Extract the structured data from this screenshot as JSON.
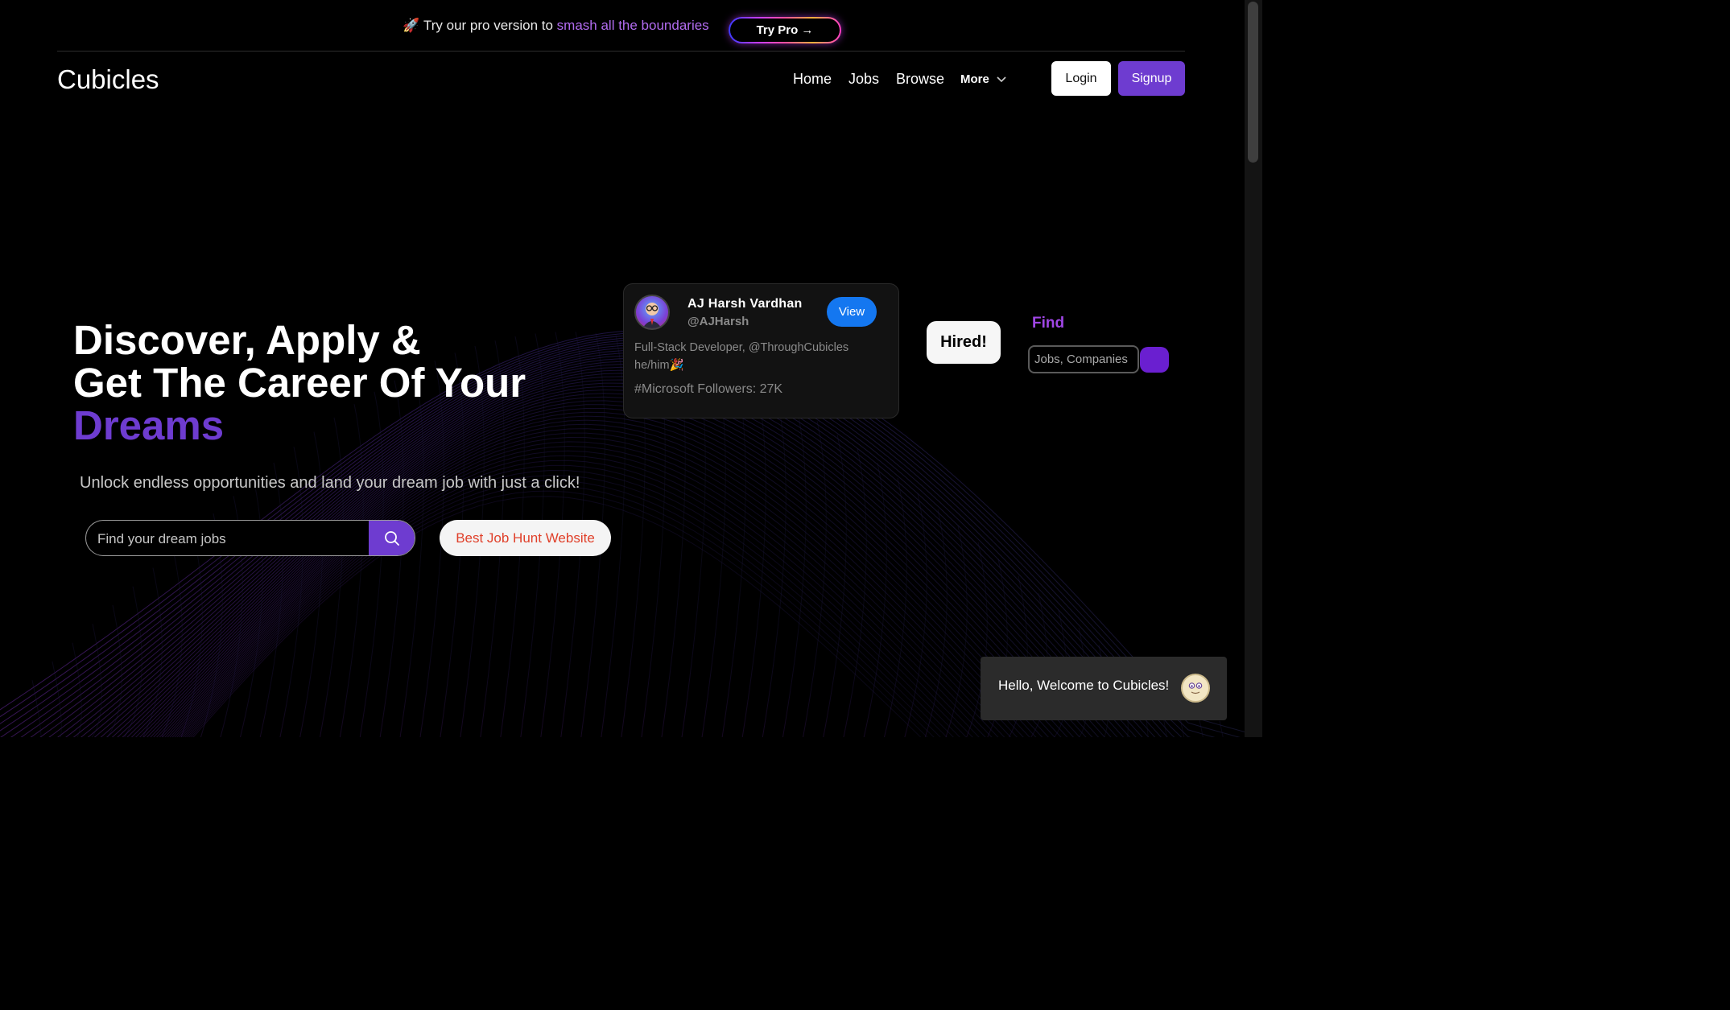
{
  "promo": {
    "text_plain": "Try our pro version to",
    "text_highlight": "smash all the boundaries",
    "cta": "Try Pro →",
    "icon": "rocket-icon"
  },
  "nav": {
    "logo": "Cubicles",
    "links": [
      "Home",
      "Jobs",
      "Browse"
    ],
    "more": "More",
    "login": "Login",
    "signup": "Signup"
  },
  "hero": {
    "line1": "Discover, Apply &",
    "line2": "Get The Career Of Your",
    "accent": "Dreams",
    "subtitle": "Unlock endless opportunities and land your dream job with just a click!",
    "search_placeholder": "Find your dream jobs",
    "badge": "Best Job Hunt Website"
  },
  "profile_card": {
    "name": "AJ Harsh Vardhan",
    "handle": "@AJHarsh",
    "view": "View",
    "bio": "Full-Stack Developer, @ThroughCubicles he/him🎉",
    "followers": "#Microsoft Followers: 27K"
  },
  "hired": "Hired!",
  "find": {
    "label": "Find",
    "placeholder": "Jobs, Companies"
  },
  "toast": {
    "text": "Hello, Welcome to Cubicles!"
  },
  "colors": {
    "accent": "#6e3cd0",
    "highlight": "#b26cf0",
    "view_button": "#1477f0",
    "badge_text": "#e0402a"
  }
}
